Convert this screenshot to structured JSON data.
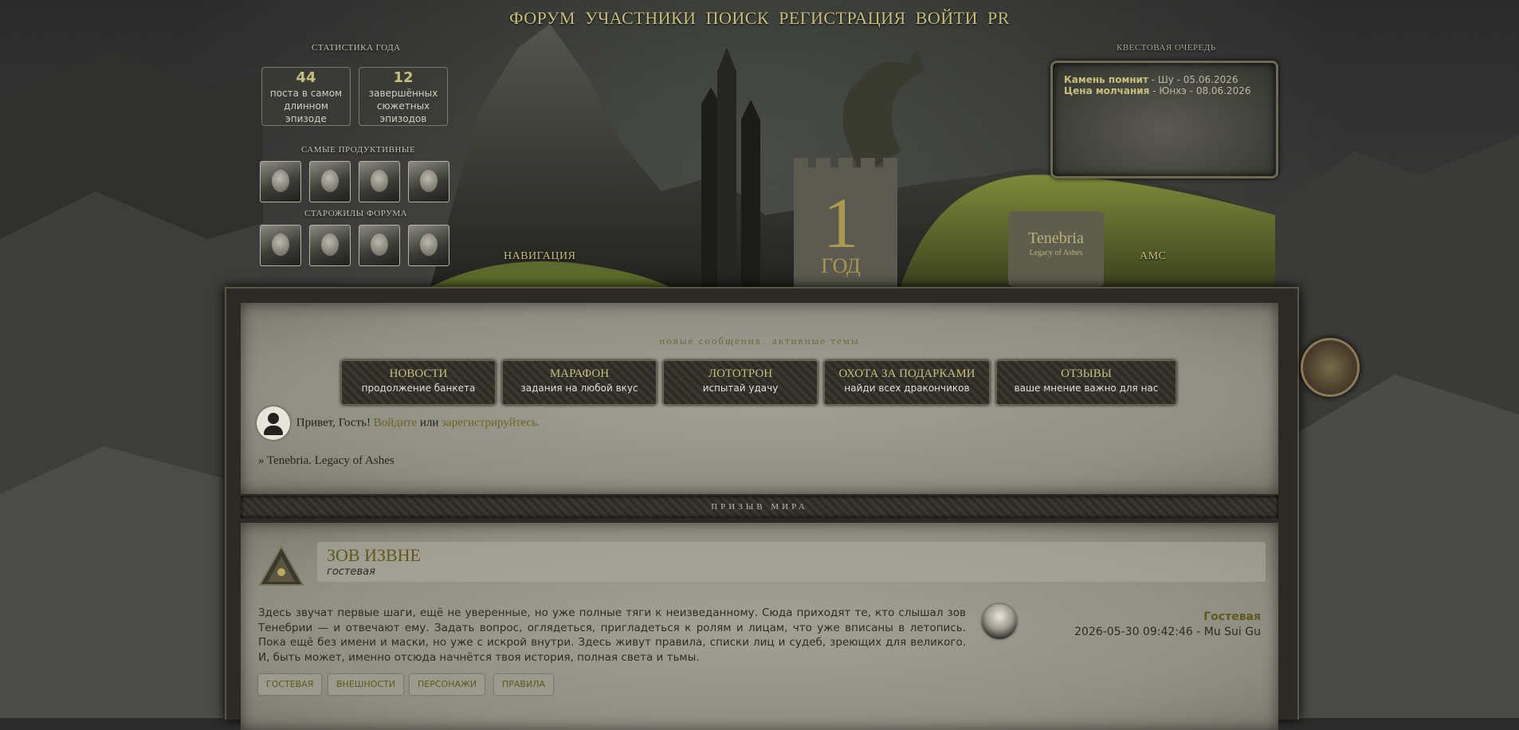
{
  "topnav": [
    "ФОРУМ",
    "УЧАСТНИКИ",
    "ПОИСК",
    "РЕГИСТРАЦИЯ",
    "ВОЙТИ",
    "PR"
  ],
  "stats": {
    "title": "СТАТИСТИКА ГОДА",
    "boxes": [
      {
        "num": "44",
        "label": "поста в самом длинном эпизоде"
      },
      {
        "num": "12",
        "label": "завершённых сюжетных эпизодов"
      }
    ],
    "productive_title": "САМЫЕ ПРОДУКТИВНЫЕ",
    "oldtimers_title": "СТАРОЖИЛЫ ФОРУМА"
  },
  "quest": {
    "title": "КВЕСТОВАЯ ОЧЕРЕДЬ",
    "items": [
      {
        "name": "Камень помнит",
        "rest": " - Шу - 05.06.2026"
      },
      {
        "name": "Цена молчания",
        "rest": " - Юнхэ - 08.06.2026"
      }
    ]
  },
  "banner": {
    "year_num": "1",
    "year_word": "ГОД",
    "logo_title": "Tenebria",
    "logo_sub": "Legacy of Ashes",
    "nav_left": "НАВИГАЦИЯ",
    "nav_right": "АМС"
  },
  "links_row": [
    "новые сообщения",
    "активные темы"
  ],
  "features": [
    {
      "title": "НОВОСТИ",
      "sub": "продолжение банкета"
    },
    {
      "title": "МАРАФОН",
      "sub": "задания на любой вкус"
    },
    {
      "title": "ЛОТОТРОН",
      "sub": "испытай удачу"
    },
    {
      "title": "ОХОТА ЗА ПОДАРКАМИ",
      "sub": "найди всех дракончиков"
    },
    {
      "title": "ОТЗЫВЫ",
      "sub": "ваше мнение важно для нас"
    }
  ],
  "welcome": {
    "greeting": "Привет, Гость!",
    "login": "Войдите",
    "or": "или",
    "register": "зарегистрируйтесь."
  },
  "breadcrumb": "» Tenebria. Legacy of Ashes",
  "section": {
    "title": "ПРИЗЫВ МИРА"
  },
  "forum": {
    "title": "ЗОВ ИЗВНЕ",
    "subtitle": "гостевая",
    "description": "Здесь звучат первые шаги, ещё не уверенные, но уже полные тяги к неизведанному. Сюда приходят те, кто слышал зов Тенебрии — и отвечают ему. Задать вопрос, оглядеться, пригладеться к ролям и лицам, что уже вписаны в летопись. Пока ещё без имени и маски, но уже с искрой внутри. Здесь живут правила, списки лиц и судеб, зреющих для великого. И, быть может, именно отсюда начнётся твоя история, полная света и тьмы.",
    "tags": [
      "ГОСТЕВАЯ",
      "ВНЕШНОСТИ",
      "ПЕРСОНАЖИ",
      "ПРАВИЛА"
    ],
    "last_post": {
      "topic": "Гостевая",
      "meta": "2026-05-30 09:42:46 - Mu Sui Gu"
    }
  }
}
